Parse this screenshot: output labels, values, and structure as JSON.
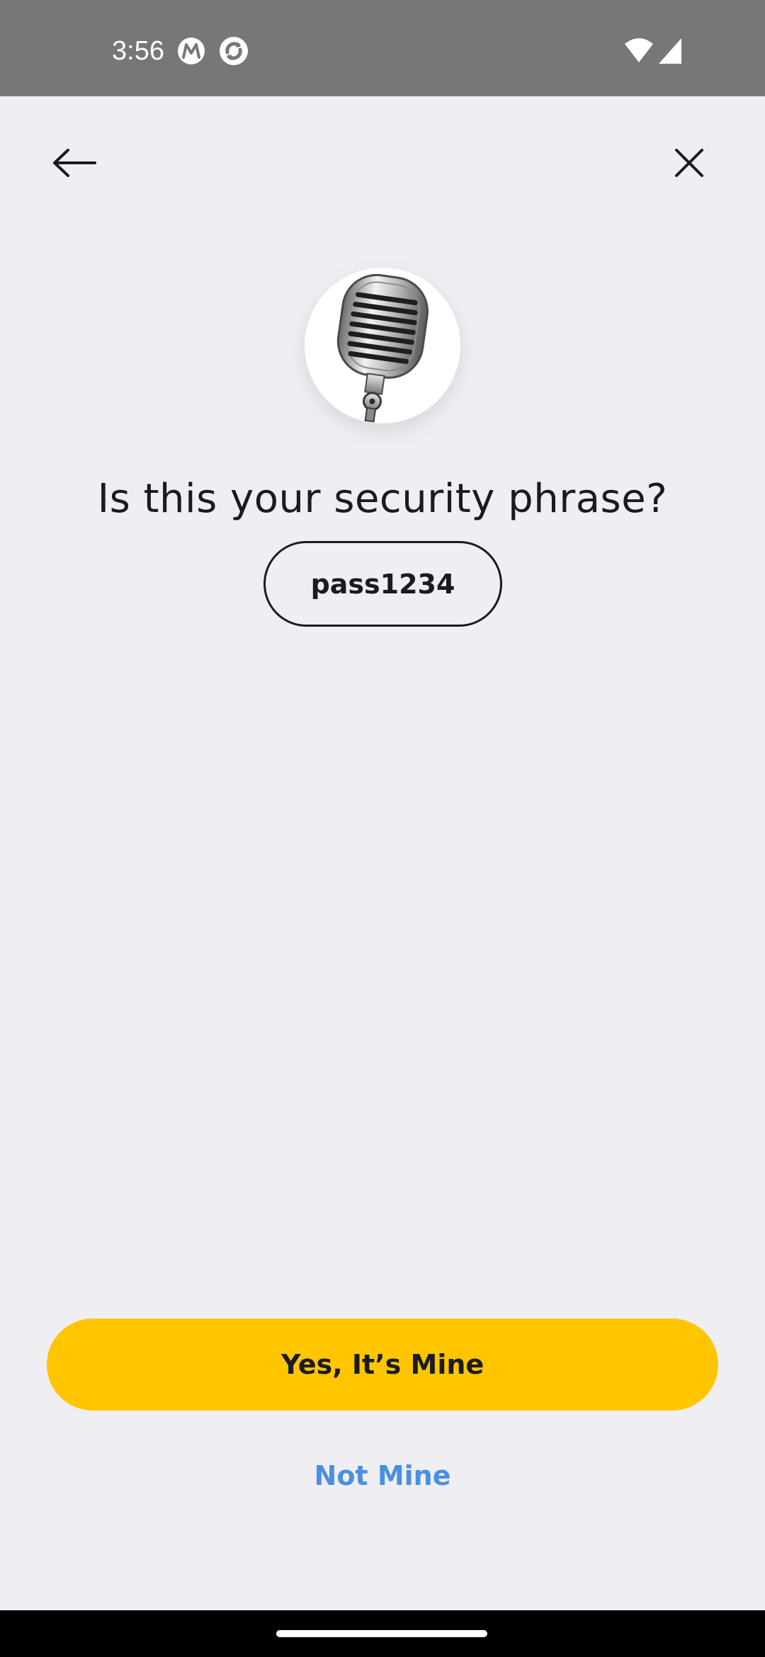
{
  "status_bar": {
    "time": "3:56",
    "background": "#777777",
    "icons": [
      "motorola-m-icon",
      "sync-app-icon",
      "wifi-icon",
      "cellular-signal-icon"
    ]
  },
  "nav": {
    "back_icon": "arrow-left-icon",
    "close_icon": "close-icon"
  },
  "avatar": {
    "icon": "microphone-icon"
  },
  "main": {
    "title": "Is this your security phrase?",
    "phrase": "pass1234"
  },
  "actions": {
    "confirm_label": "Yes, It’s Mine",
    "reject_label": "Not Mine",
    "confirm_color": "#ffc600",
    "reject_color": "#4a90e2"
  },
  "colors": {
    "background": "#efeef3",
    "text": "#1b1b1f"
  }
}
